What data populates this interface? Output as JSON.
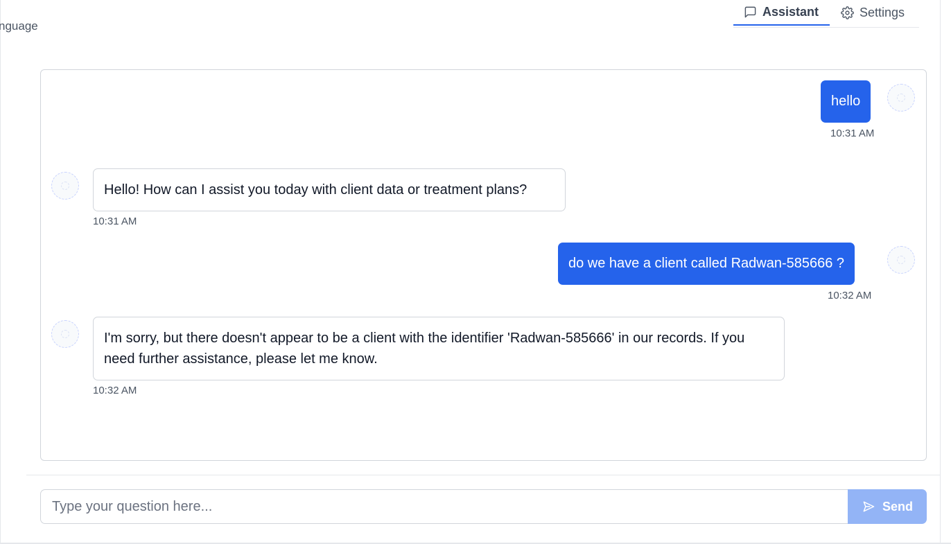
{
  "header": {
    "language_label": "nguage",
    "tabs": [
      {
        "label": "Assistant",
        "icon": "message-square-icon",
        "active": true
      },
      {
        "label": "Settings",
        "icon": "gear-icon",
        "active": false
      }
    ]
  },
  "chat": {
    "messages": [
      {
        "role": "user",
        "text": "hello",
        "time": "10:31 AM"
      },
      {
        "role": "assistant",
        "text": "Hello! How can I assist you today with client data or treatment plans?",
        "time": "10:31 AM"
      },
      {
        "role": "user",
        "text": "do we have a client called Radwan-585666 ?",
        "time": "10:32 AM"
      },
      {
        "role": "assistant",
        "text": "I'm sorry, but there doesn't appear to be a client with the identifier 'Radwan-585666' in our records. If you need further assistance, please let me know.",
        "time": "10:32 AM"
      }
    ]
  },
  "composer": {
    "placeholder": "Type your question here...",
    "value": "",
    "send_label": "Send",
    "send_icon": "send-icon"
  },
  "colors": {
    "accent": "#2563eb",
    "send_disabled": "#93b4f6",
    "border": "#d1d5db"
  }
}
